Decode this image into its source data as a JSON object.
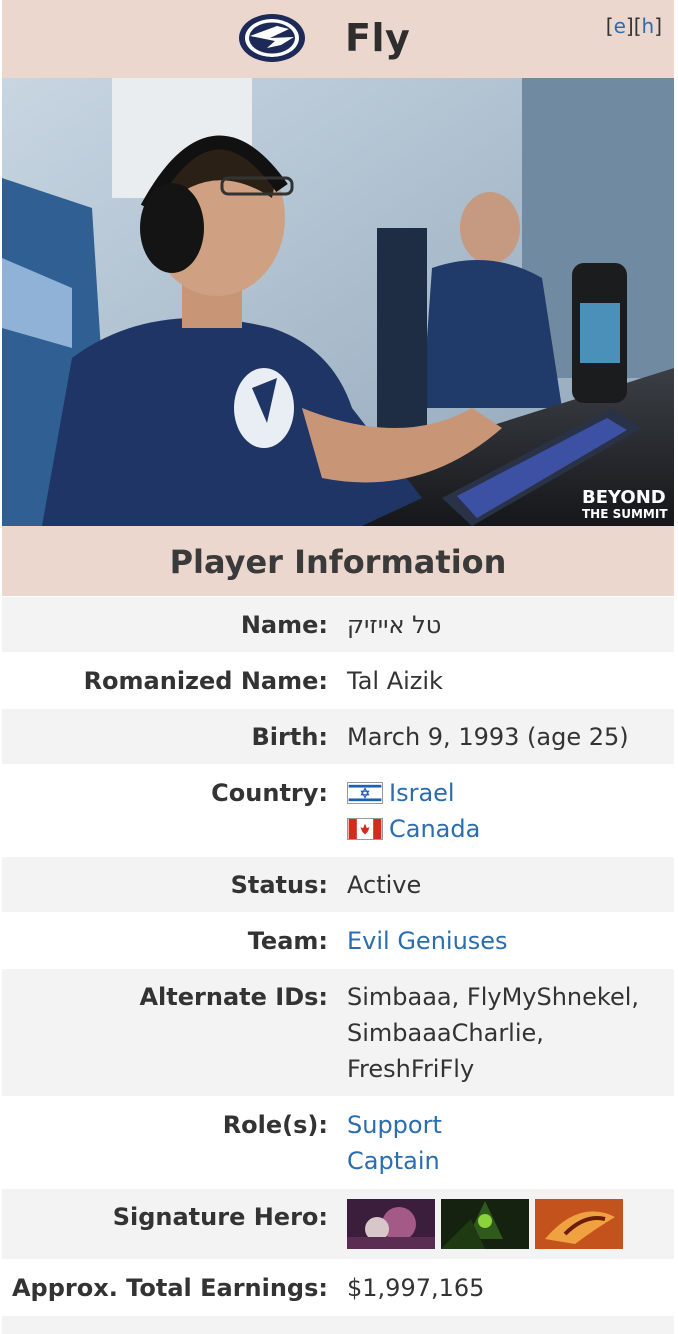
{
  "header": {
    "title": "Fly",
    "edit_open": "[",
    "edit_e": "e",
    "edit_mid": "][",
    "edit_h": "h",
    "edit_close": "]"
  },
  "section_title": "Player Information",
  "rows": {
    "name": {
      "label": "Name:",
      "value": "טל אייזיק"
    },
    "romanized": {
      "label": "Romanized Name:",
      "value": "Tal Aizik"
    },
    "birth": {
      "label": "Birth:",
      "value": "March 9, 1993 (age 25)"
    },
    "country": {
      "label": "Country:",
      "values": [
        "Israel",
        "Canada"
      ]
    },
    "status": {
      "label": "Status:",
      "value": "Active"
    },
    "team": {
      "label": "Team:",
      "value": "Evil Geniuses"
    },
    "alt_ids": {
      "label": "Alternate IDs:",
      "lines": [
        "Simbaaa, FlyMyShnekel,",
        "SimbaaaCharlie,",
        "FreshFriFly"
      ]
    },
    "roles": {
      "label": "Role(s):",
      "values": [
        "Support",
        "Captain"
      ]
    },
    "signature": {
      "label": "Signature Hero:"
    },
    "earnings": {
      "label": "Approx. Total Earnings:",
      "value": "$1,997,165"
    }
  },
  "colors": {
    "header_bg": "#ecd7cf",
    "link": "#2a6db0",
    "row_shade": "#f3f3f3"
  },
  "icons": {
    "team_logo": "evil-geniuses-logo-icon",
    "flags": [
      "israel-flag-icon",
      "canada-flag-icon"
    ],
    "heroes": [
      "hero-1-icon",
      "hero-2-icon",
      "hero-3-icon"
    ]
  }
}
